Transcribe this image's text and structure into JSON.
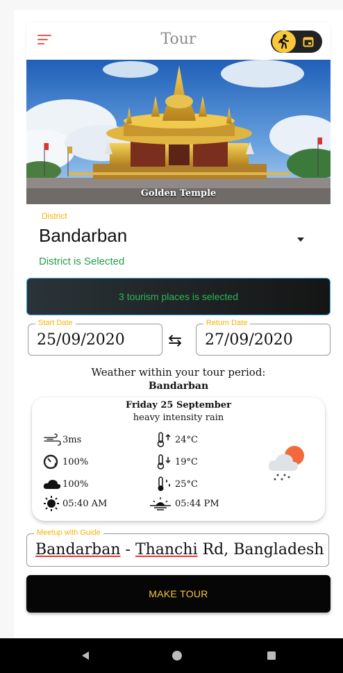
{
  "header": {
    "title": "Tour",
    "menu_icon": "hamburger-menu-icon",
    "toggle_left_icon": "hiking-icon",
    "toggle_right_icon": "calendar-icon"
  },
  "hero": {
    "caption": "Golden Temple"
  },
  "district": {
    "label": "District",
    "value": "Bandarban",
    "status": "District is Selected"
  },
  "places_button": {
    "label": "3 tourism places is selected"
  },
  "dates": {
    "start_label": "Start Date",
    "start_value": "25/09/2020",
    "return_label": "Return Date",
    "return_value": "27/09/2020",
    "swap_icon": "⇆"
  },
  "weather": {
    "heading": "Weather within your tour period:",
    "city": "Bandarban",
    "day": "Friday 25 September",
    "description": "heavy intensity rain",
    "wind": "3ms",
    "humidity": "100%",
    "clouds": "100%",
    "sunrise": "05:40 AM",
    "temp_max": "24°C",
    "temp_min": "19°C",
    "feels_like": "25°C",
    "sunset": "05:44 PM"
  },
  "meetup": {
    "label": "Meetup with Guide",
    "value_part1": "Bandarban",
    "value_sep": " - ",
    "value_part2": "Thanchi",
    "value_part3": " Rd, Bangladesh"
  },
  "make_tour": {
    "label": "MAKE TOUR"
  },
  "colors": {
    "accent": "#f9c93a",
    "success": "#22a047",
    "menu": "#f0554a",
    "label": "#f5b400"
  }
}
